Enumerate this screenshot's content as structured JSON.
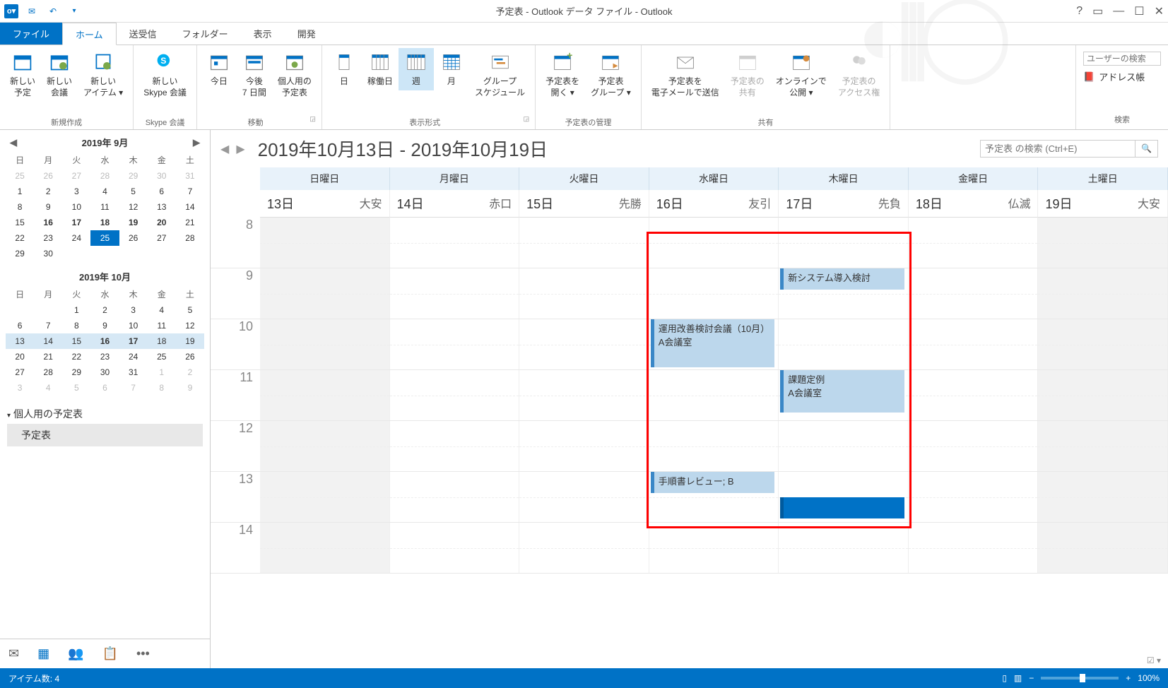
{
  "title": "予定表 - Outlook データ ファイル - Outlook",
  "tabs": {
    "file": "ファイル",
    "home": "ホーム",
    "sendrecv": "送受信",
    "folder": "フォルダー",
    "view": "表示",
    "dev": "開発"
  },
  "ribbon": {
    "new_appt": "新しい\n予定",
    "new_meeting": "新しい\n会議",
    "new_items": "新しい\nアイテム ▾",
    "new_skype": "新しい\nSkype 会議",
    "today": "今日",
    "next7": "今後\n7 日間",
    "personal": "個人用の\n予定表",
    "day": "日",
    "workweek": "稼働日",
    "week": "週",
    "month": "月",
    "group_sched": "グループ\nスケジュール",
    "open_cal": "予定表を\n開く ▾",
    "cal_groups": "予定表\nグループ ▾",
    "email_cal": "予定表を\n電子メールで送信",
    "share_cal": "予定表の\n共有",
    "publish": "オンラインで\n公開 ▾",
    "perms": "予定表の\nアクセス権",
    "user_search": "ユーザーの検索",
    "addr_book": "アドレス帳",
    "groups": {
      "new": "新規作成",
      "skype": "Skype 会議",
      "goto": "移動",
      "arrange": "表示形式",
      "manage": "予定表の管理",
      "share": "共有",
      "find": "検索"
    }
  },
  "minical1": {
    "title": "2019年 9月",
    "dows": [
      "日",
      "月",
      "火",
      "水",
      "木",
      "金",
      "土"
    ],
    "rows": [
      [
        {
          "d": "25",
          "o": 1
        },
        {
          "d": "26",
          "o": 1
        },
        {
          "d": "27",
          "o": 1
        },
        {
          "d": "28",
          "o": 1
        },
        {
          "d": "29",
          "o": 1
        },
        {
          "d": "30",
          "o": 1
        },
        {
          "d": "31",
          "o": 1
        }
      ],
      [
        {
          "d": "1"
        },
        {
          "d": "2"
        },
        {
          "d": "3"
        },
        {
          "d": "4"
        },
        {
          "d": "5"
        },
        {
          "d": "6"
        },
        {
          "d": "7"
        }
      ],
      [
        {
          "d": "8"
        },
        {
          "d": "9"
        },
        {
          "d": "10"
        },
        {
          "d": "11"
        },
        {
          "d": "12"
        },
        {
          "d": "13"
        },
        {
          "d": "14"
        }
      ],
      [
        {
          "d": "15"
        },
        {
          "d": "16",
          "b": 1
        },
        {
          "d": "17",
          "b": 1
        },
        {
          "d": "18",
          "b": 1
        },
        {
          "d": "19",
          "b": 1
        },
        {
          "d": "20",
          "b": 1
        },
        {
          "d": "21"
        }
      ],
      [
        {
          "d": "22"
        },
        {
          "d": "23"
        },
        {
          "d": "24"
        },
        {
          "d": "25",
          "t": 1
        },
        {
          "d": "26"
        },
        {
          "d": "27"
        },
        {
          "d": "28"
        }
      ],
      [
        {
          "d": "29"
        },
        {
          "d": "30"
        },
        {
          "d": ""
        },
        {
          "d": ""
        },
        {
          "d": ""
        },
        {
          "d": ""
        },
        {
          "d": ""
        }
      ]
    ]
  },
  "minical2": {
    "title": "2019年 10月",
    "dows": [
      "日",
      "月",
      "火",
      "水",
      "木",
      "金",
      "土"
    ],
    "rows": [
      [
        {
          "d": ""
        },
        {
          "d": ""
        },
        {
          "d": "1"
        },
        {
          "d": "2"
        },
        {
          "d": "3"
        },
        {
          "d": "4"
        },
        {
          "d": "5"
        }
      ],
      [
        {
          "d": "6"
        },
        {
          "d": "7"
        },
        {
          "d": "8"
        },
        {
          "d": "9"
        },
        {
          "d": "10"
        },
        {
          "d": "11"
        },
        {
          "d": "12"
        }
      ],
      [
        {
          "d": "13",
          "h": 1
        },
        {
          "d": "14",
          "h": 1
        },
        {
          "d": "15",
          "h": 1
        },
        {
          "d": "16",
          "b": 1,
          "h": 1
        },
        {
          "d": "17",
          "b": 1,
          "h": 1
        },
        {
          "d": "18",
          "h": 1
        },
        {
          "d": "19",
          "h": 1
        }
      ],
      [
        {
          "d": "20"
        },
        {
          "d": "21"
        },
        {
          "d": "22"
        },
        {
          "d": "23"
        },
        {
          "d": "24"
        },
        {
          "d": "25"
        },
        {
          "d": "26"
        }
      ],
      [
        {
          "d": "27"
        },
        {
          "d": "28"
        },
        {
          "d": "29"
        },
        {
          "d": "30"
        },
        {
          "d": "31"
        },
        {
          "d": "1",
          "o": 1
        },
        {
          "d": "2",
          "o": 1
        }
      ],
      [
        {
          "d": "3",
          "o": 1
        },
        {
          "d": "4",
          "o": 1
        },
        {
          "d": "5",
          "o": 1
        },
        {
          "d": "6",
          "o": 1
        },
        {
          "d": "7",
          "o": 1
        },
        {
          "d": "8",
          "o": 1
        },
        {
          "d": "9",
          "o": 1
        }
      ]
    ]
  },
  "my_calendars_header": "個人用の予定表",
  "my_calendar_item": "予定表",
  "view": {
    "range_title": "2019年10月13日 - 2019年10月19日",
    "search_placeholder": "予定表 の検索 (Ctrl+E)",
    "dows": [
      "日曜日",
      "月曜日",
      "火曜日",
      "水曜日",
      "木曜日",
      "金曜日",
      "土曜日"
    ],
    "dates": [
      {
        "d": "13日",
        "r": "大安"
      },
      {
        "d": "14日",
        "r": "赤口"
      },
      {
        "d": "15日",
        "r": "先勝"
      },
      {
        "d": "16日",
        "r": "友引"
      },
      {
        "d": "17日",
        "r": "先負"
      },
      {
        "d": "18日",
        "r": "仏滅"
      },
      {
        "d": "19日",
        "r": "大安"
      }
    ],
    "hours": [
      "8",
      "9",
      "10",
      "11",
      "12",
      "13",
      "14"
    ],
    "events": {
      "e1": "新システム導入検討",
      "e2": "運用改善検討会議（10月）\nA会議室",
      "e3": "課題定例\nA会議室",
      "e4": "手順書レビュー; B"
    }
  },
  "status": {
    "items": "アイテム数: 4",
    "zoom": "100%"
  }
}
